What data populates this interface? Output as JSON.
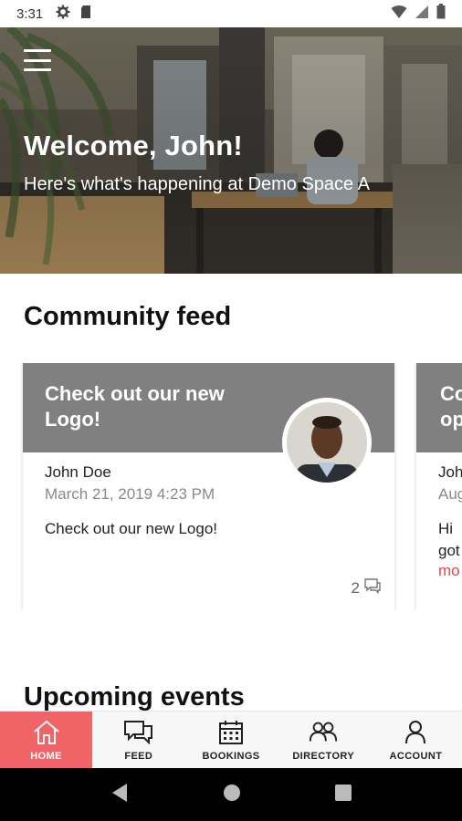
{
  "status_bar": {
    "time": "3:31",
    "left_icons": [
      "gear-icon",
      "sd-card-icon"
    ],
    "right_icons": [
      "wifi-icon",
      "signal-icon",
      "battery-icon"
    ]
  },
  "hero": {
    "title": "Welcome, John!",
    "subtitle": "Here's what's happening at Demo Space A"
  },
  "community_feed": {
    "title": "Community feed",
    "cards": [
      {
        "header": "Check out our new Logo!",
        "author": "John Doe",
        "date": "March 21, 2019 4:23 PM",
        "body": "Check out our new Logo!",
        "comments": "2"
      },
      {
        "header": "Co op",
        "author": "Joh",
        "date": "Aug",
        "body": "Hi got",
        "more": "mo"
      }
    ]
  },
  "upcoming_events": {
    "title": "Upcoming events"
  },
  "bottom_nav": {
    "items": [
      {
        "label": "HOME",
        "icon": "home-icon",
        "active": true
      },
      {
        "label": "FEED",
        "icon": "chat-icon",
        "active": false
      },
      {
        "label": "BOOKINGS",
        "icon": "calendar-icon",
        "active": false
      },
      {
        "label": "DIRECTORY",
        "icon": "people-icon",
        "active": false
      },
      {
        "label": "ACCOUNT",
        "icon": "person-icon",
        "active": false
      }
    ]
  },
  "colors": {
    "accent": "#f06468",
    "card_header": "#808080",
    "link": "#e8454a"
  }
}
